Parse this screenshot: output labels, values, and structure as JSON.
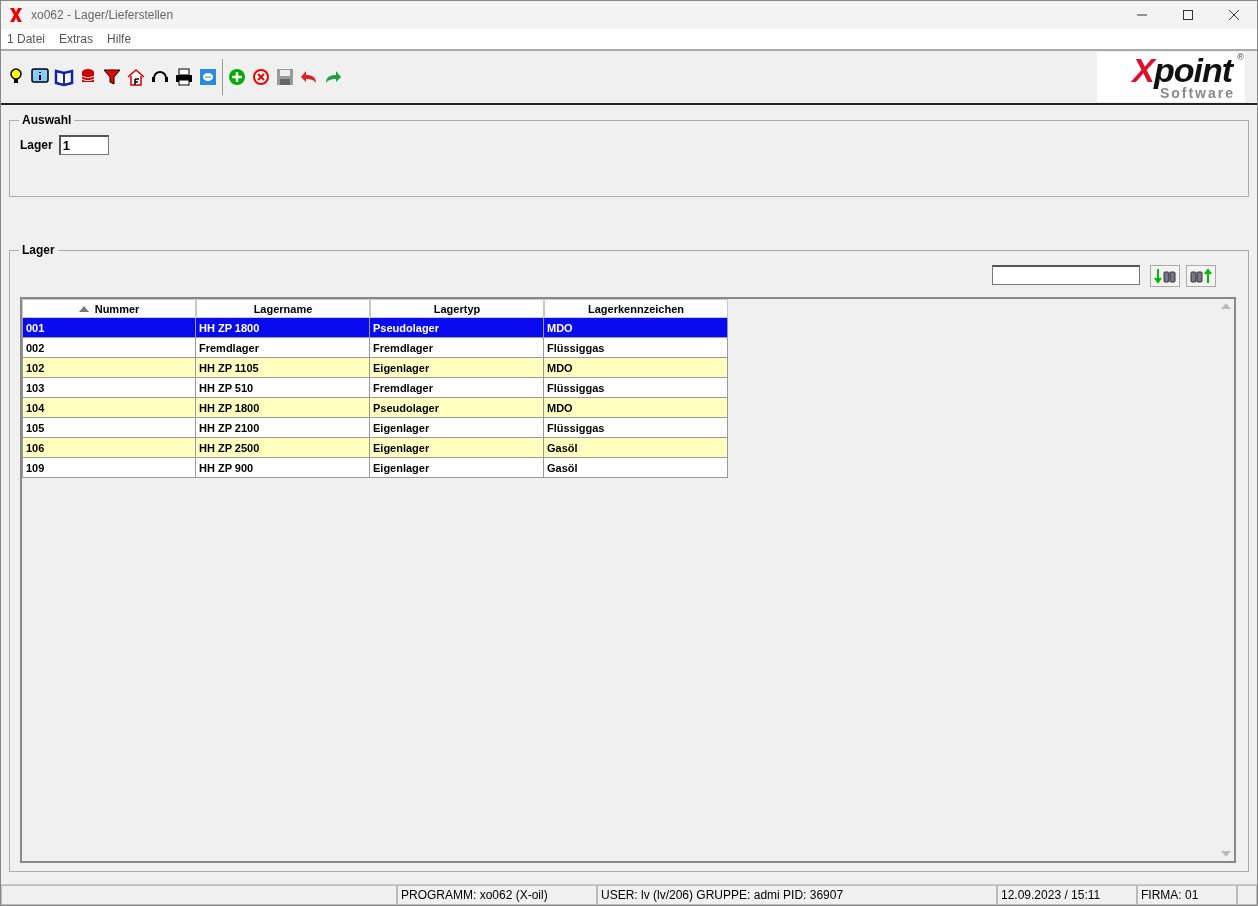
{
  "window": {
    "title": "xo062 - Lager/Lieferstellen"
  },
  "menu": [
    "1 Datei",
    "Extras",
    "Hilfe"
  ],
  "logo": {
    "main": "Xpoint",
    "sub": "Software",
    "mark": "®"
  },
  "auswahl": {
    "title": "Auswahl",
    "label": "Lager",
    "value": "1"
  },
  "lager": {
    "title": "Lager",
    "columns": [
      {
        "label": "Nummer",
        "sorted": true
      },
      {
        "label": "Lagername",
        "sorted": false
      },
      {
        "label": "Lagertyp",
        "sorted": false
      },
      {
        "label": "Lagerkennzeichen",
        "sorted": false
      }
    ],
    "rows": [
      {
        "cells": [
          "001",
          "HH ZP 1800",
          "Pseudolager",
          "MDO"
        ],
        "selected": true
      },
      {
        "cells": [
          "002",
          "Fremdlager",
          "Fremdlager",
          "Flüssiggas"
        ],
        "selected": false
      },
      {
        "cells": [
          "102",
          "HH ZP 1105",
          "Eigenlager",
          "MDO"
        ],
        "selected": false
      },
      {
        "cells": [
          "103",
          "HH ZP 510",
          "Fremdlager",
          "Flüssiggas"
        ],
        "selected": false
      },
      {
        "cells": [
          "104",
          "HH ZP 1800",
          "Pseudolager",
          "MDO"
        ],
        "selected": false
      },
      {
        "cells": [
          "105",
          "HH ZP 2100",
          "Eigenlager",
          "Flüssiggas"
        ],
        "selected": false
      },
      {
        "cells": [
          "106",
          "HH ZP 2500",
          "Eigenlager",
          "Gasöl"
        ],
        "selected": false
      },
      {
        "cells": [
          "109",
          "HH ZP 900",
          "Eigenlager",
          "Gasöl"
        ],
        "selected": false
      }
    ]
  },
  "status_bar": [
    "PROGRAMM: xo062 (X-oil)",
    "USER: lv (lv/206)  GRUPPE: admi  PID: 36907",
    "12.09.2023 / 15:11",
    "FIRMA: 01"
  ]
}
